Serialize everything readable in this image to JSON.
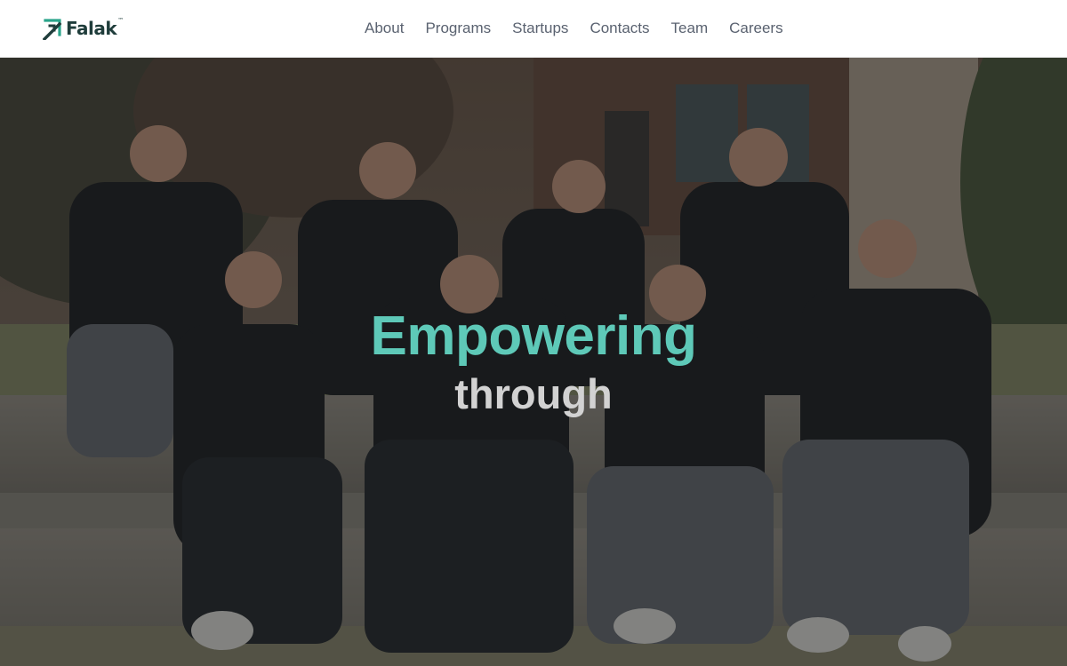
{
  "header": {
    "logo": {
      "text": "Falak",
      "tm": "™",
      "icon": "arrow-up-right-icon",
      "color": "#1f3d3b",
      "accent": "#2aa58b"
    },
    "nav": [
      {
        "label": "About"
      },
      {
        "label": "Programs"
      },
      {
        "label": "Startups"
      },
      {
        "label": "Contacts"
      },
      {
        "label": "Team"
      },
      {
        "label": "Careers"
      }
    ]
  },
  "hero": {
    "headline": "Empowering",
    "subline": "through",
    "headline_color": "#5ec9b8",
    "subline_color": "#d2d2d2"
  }
}
